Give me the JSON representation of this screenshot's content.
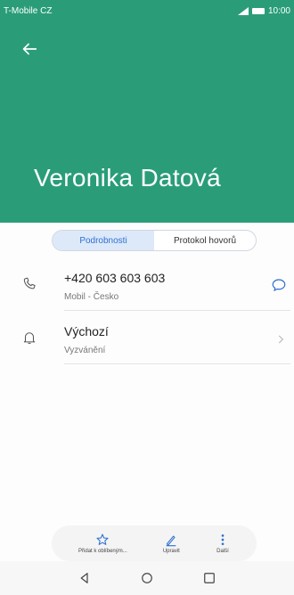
{
  "status_bar": {
    "carrier": "T-Mobile CZ",
    "time": "10:00"
  },
  "header": {
    "name": "Veronika Datová"
  },
  "tabs": [
    {
      "label": "Podrobnosti",
      "active": true
    },
    {
      "label": "Protokol hovorů",
      "active": false
    }
  ],
  "rows": [
    {
      "main": "+420 603 603 603",
      "sub": "Mobil - Česko",
      "icon": "phone-icon"
    },
    {
      "main": "Výchozí",
      "sub": "Vyzvánění",
      "icon": "bell-icon"
    }
  ],
  "actions": [
    {
      "label": "Přidat k oblíbeným...",
      "icon": "star-icon"
    },
    {
      "label": "Upravit",
      "icon": "pencil-icon"
    },
    {
      "label": "Další",
      "icon": "more-vertical-icon"
    }
  ],
  "colors": {
    "header": "#2a9d78",
    "accent": "#2d6fd1"
  }
}
